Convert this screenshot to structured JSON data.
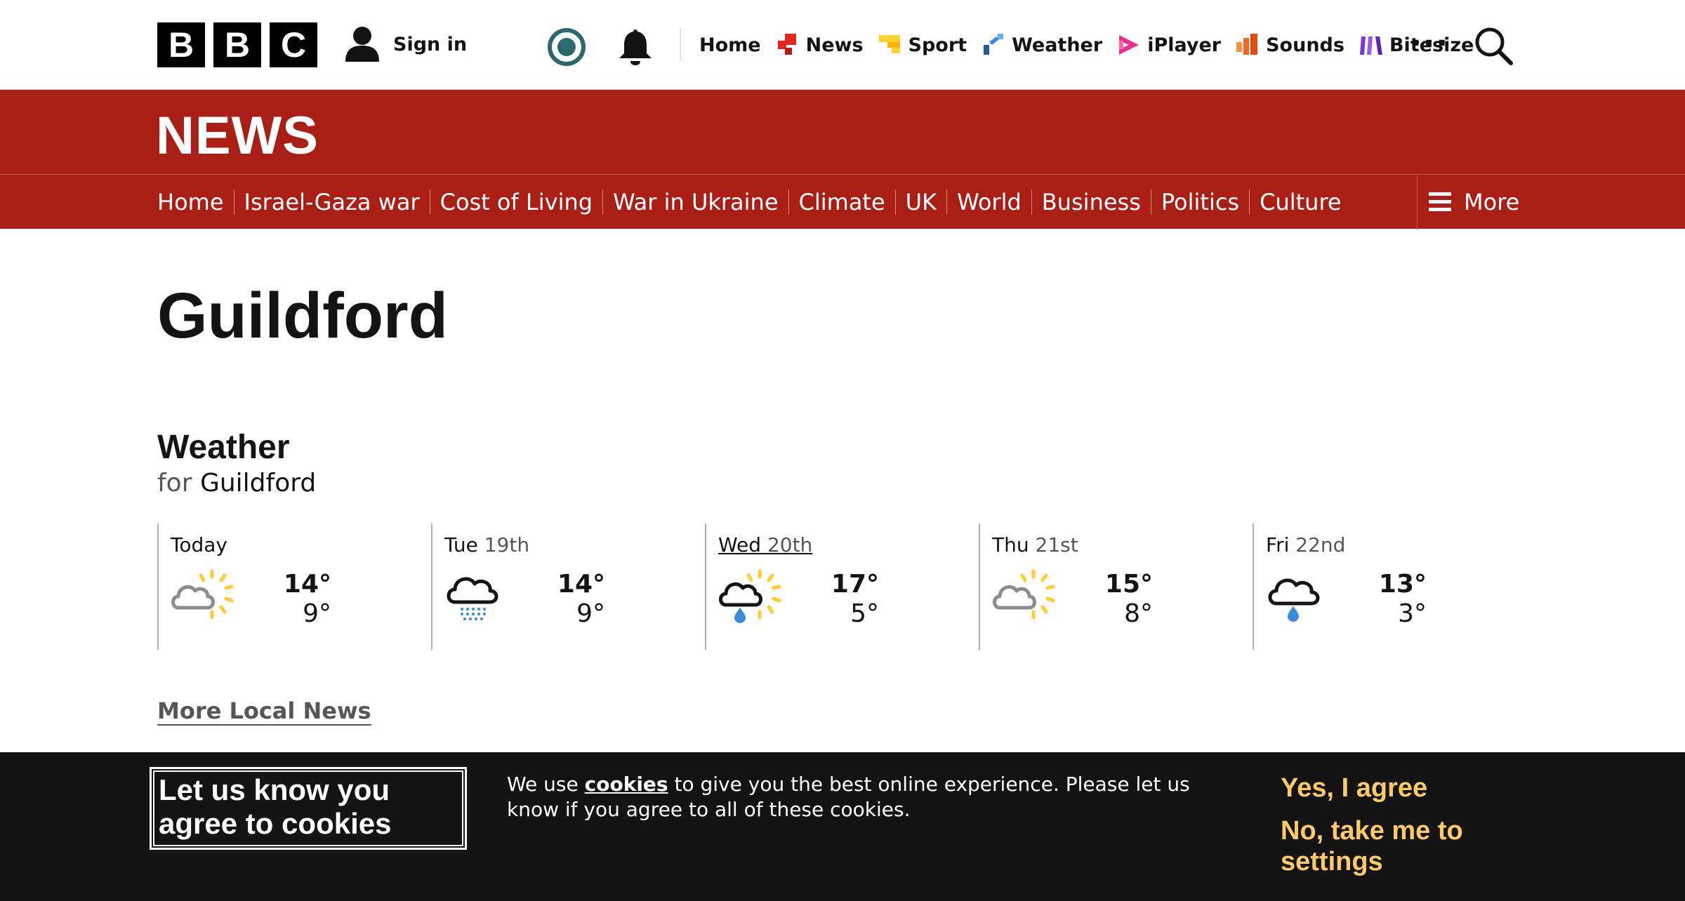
{
  "masthead": {
    "logo_letters": [
      "B",
      "B",
      "C"
    ],
    "sign_in": "Sign in",
    "more": "···",
    "nav": [
      {
        "label": "Home",
        "icon": "none"
      },
      {
        "label": "News",
        "icon": "news-icon",
        "color": "#e1261c"
      },
      {
        "label": "Sport",
        "icon": "sport-icon",
        "color": "#ffd230"
      },
      {
        "label": "Weather",
        "icon": "weather-icon",
        "color": "#3a8bd8"
      },
      {
        "label": "iPlayer",
        "icon": "iplayer-icon",
        "color": "#e8318a"
      },
      {
        "label": "Sounds",
        "icon": "sounds-icon",
        "color": "#f26522"
      },
      {
        "label": "Bitesize",
        "icon": "bitesize-icon",
        "color": "#7b36d6"
      }
    ]
  },
  "news": {
    "title": "NEWS",
    "nav": [
      "Home",
      "Israel-Gaza war",
      "Cost of Living",
      "War in Ukraine",
      "Climate",
      "UK",
      "World",
      "Business",
      "Politics",
      "Culture"
    ],
    "more": "More"
  },
  "page": {
    "title": "Guildford",
    "weather_heading": "Weather",
    "weather_for": "for",
    "weather_location": "Guildford",
    "more_local": "More Local News"
  },
  "forecast": [
    {
      "day": "Today",
      "date": "",
      "icon": "sunny-intervals-icon",
      "high": "14°",
      "low": "9°"
    },
    {
      "day": "Tue",
      "date": "19th",
      "icon": "light-rain-icon",
      "high": "14°",
      "low": "9°"
    },
    {
      "day": "Wed",
      "date": "20th",
      "icon": "sun-and-showers-icon",
      "high": "17°",
      "low": "5°"
    },
    {
      "day": "Thu",
      "date": "21st",
      "icon": "sunny-intervals-icon",
      "high": "15°",
      "low": "8°"
    },
    {
      "day": "Fri",
      "date": "22nd",
      "icon": "showers-icon",
      "high": "13°",
      "low": "3°"
    }
  ],
  "cookie": {
    "heading": "Let us know you agree to cookies",
    "text_before": "We use ",
    "link": "cookies",
    "text_after": " to give you the best online experience. Please let us know if you agree to all of these cookies.",
    "yes": "Yes, I agree",
    "no": "No, take me to settings"
  },
  "colors": {
    "news_red": "#a91f16",
    "cookie_bg": "#141414",
    "cookie_accent": "#fcca68"
  }
}
